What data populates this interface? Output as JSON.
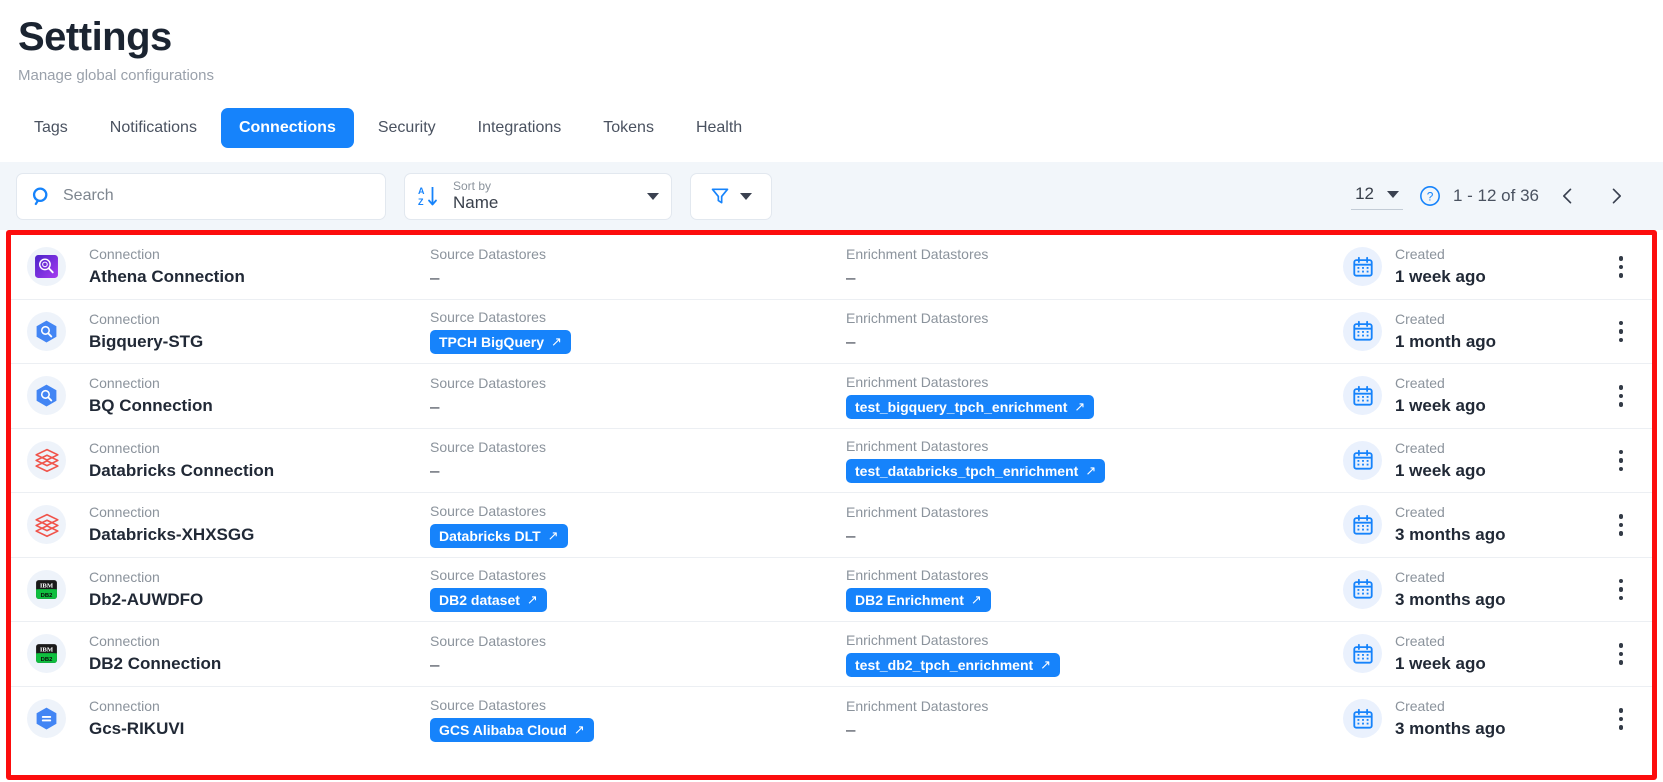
{
  "header": {
    "title": "Settings",
    "subtitle": "Manage global configurations"
  },
  "tabs": [
    {
      "label": "Tags",
      "active": false
    },
    {
      "label": "Notifications",
      "active": false
    },
    {
      "label": "Connections",
      "active": true
    },
    {
      "label": "Security",
      "active": false
    },
    {
      "label": "Integrations",
      "active": false
    },
    {
      "label": "Tokens",
      "active": false
    },
    {
      "label": "Health",
      "active": false
    }
  ],
  "toolbar": {
    "search_placeholder": "Search",
    "search_value": "",
    "sort_label": "Sort by",
    "sort_value": "Name",
    "filter_label": "",
    "page_size": "12",
    "page_range": "1 - 12 of 36"
  },
  "table": {
    "labels": {
      "type": "Connection",
      "source": "Source Datastores",
      "enrichment": "Enrichment Datastores",
      "created": "Created"
    },
    "empty": "–",
    "rows": [
      {
        "icon": "athena-icon",
        "type": "Connection",
        "name": "Athena Connection",
        "source_label": "Source Datastores",
        "source": "",
        "enrichment_label": "Enrichment Datastores",
        "enrichment": "",
        "created_label": "Created",
        "created": "1 week ago"
      },
      {
        "icon": "bigquery-icon",
        "type": "Connection",
        "name": "Bigquery-STG",
        "source_label": "Source Datastores",
        "source": "TPCH BigQuery",
        "enrichment_label": "Enrichment Datastores",
        "enrichment": "",
        "created_label": "Created",
        "created": "1 month ago"
      },
      {
        "icon": "bigquery-icon",
        "type": "Connection",
        "name": "BQ Connection",
        "source_label": "Source Datastores",
        "source": "",
        "enrichment_label": "Enrichment Datastores",
        "enrichment": "test_bigquery_tpch_enrichment",
        "created_label": "Created",
        "created": "1 week ago"
      },
      {
        "icon": "databricks-icon",
        "type": "Connection",
        "name": "Databricks Connection",
        "source_label": "Source Datastores",
        "source": "",
        "enrichment_label": "Enrichment Datastores",
        "enrichment": "test_databricks_tpch_enrichment",
        "created_label": "Created",
        "created": "1 week ago"
      },
      {
        "icon": "databricks-icon",
        "type": "Connection",
        "name": "Databricks-XHXSGG",
        "source_label": "Source Datastores",
        "source": "Databricks DLT",
        "enrichment_label": "Enrichment Datastores",
        "enrichment": "",
        "created_label": "Created",
        "created": "3 months ago"
      },
      {
        "icon": "db2-icon",
        "type": "Connection",
        "name": "Db2-AUWDFO",
        "source_label": "Source Datastores",
        "source": "DB2 dataset",
        "enrichment_label": "Enrichment Datastores",
        "enrichment": "DB2 Enrichment",
        "created_label": "Created",
        "created": "3 months ago"
      },
      {
        "icon": "db2-icon",
        "type": "Connection",
        "name": "DB2 Connection",
        "source_label": "Source Datastores",
        "source": "",
        "enrichment_label": "Enrichment Datastores",
        "enrichment": "test_db2_tpch_enrichment",
        "created_label": "Created",
        "created": "1 week ago"
      },
      {
        "icon": "gcs-icon",
        "type": "Connection",
        "name": "Gcs-RIKUVI",
        "source_label": "Source Datastores",
        "source": "GCS Alibaba Cloud",
        "enrichment_label": "Enrichment Datastores",
        "enrichment": "",
        "created_label": "Created",
        "created": "3 months ago"
      }
    ]
  },
  "colors": {
    "accent": "#1683fb",
    "highlight_border": "#fc0d0d",
    "toolbar_bg": "#f2f6fa",
    "title": "#1b2431"
  }
}
